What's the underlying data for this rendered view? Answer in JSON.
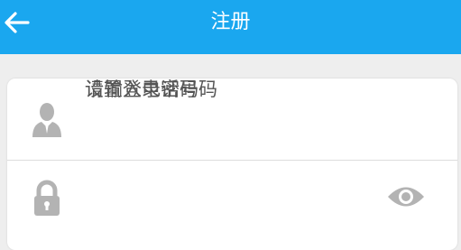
{
  "header": {
    "title": "注册",
    "back_icon": "arrow-left-icon"
  },
  "form": {
    "phone": {
      "icon": "user-icon",
      "placeholder": "请输入电话号码",
      "value": ""
    },
    "password": {
      "icon": "lock-icon",
      "placeholder": "设置登录密码",
      "value": "",
      "toggle_icon": "eye-icon"
    }
  },
  "colors": {
    "header_bg": "#1aa7ef",
    "page_bg": "#eeeeee",
    "card_bg": "#ffffff",
    "icon_gray": "#b3b3b3"
  }
}
